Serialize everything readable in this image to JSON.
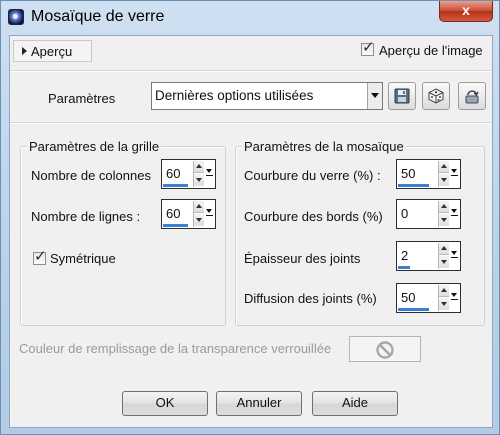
{
  "window": {
    "title": "Mosaïque de verre",
    "close_glyph": "x"
  },
  "preview": {
    "toggle_label": "Aperçu",
    "show_preview_label": "Aperçu de l'image",
    "show_preview_checked": true
  },
  "presets": {
    "label": "Paramètres",
    "value": "Dernières options utilisées"
  },
  "grid": {
    "title": "Paramètres de la grille",
    "columns": {
      "label": "Nombre de colonnes",
      "value": "60",
      "fill": 0.6
    },
    "rows": {
      "label": "Nombre de lignes :",
      "value": "60",
      "fill": 0.6
    },
    "symmetric": {
      "label": "Symétrique",
      "checked": true
    }
  },
  "mosaic": {
    "title": "Paramètres de la mosaïque",
    "glass_curvature": {
      "label": "Courbure du verre (%) :",
      "value": "50",
      "fill": 0.5
    },
    "edge_curvature": {
      "label": "Courbure des bords (%)",
      "value": "0",
      "fill": 0.0
    },
    "grout_thickness": {
      "label": "Épaisseur des joints",
      "value": "2",
      "fill": 0.1
    },
    "grout_diffusion": {
      "label": "Diffusion des joints (%)",
      "value": "50",
      "fill": 0.5
    }
  },
  "transparency_fill": {
    "label": "Couleur de remplissage de la transparence verrouillée"
  },
  "buttons": {
    "ok": "OK",
    "cancel": "Annuler",
    "help": "Aide"
  }
}
